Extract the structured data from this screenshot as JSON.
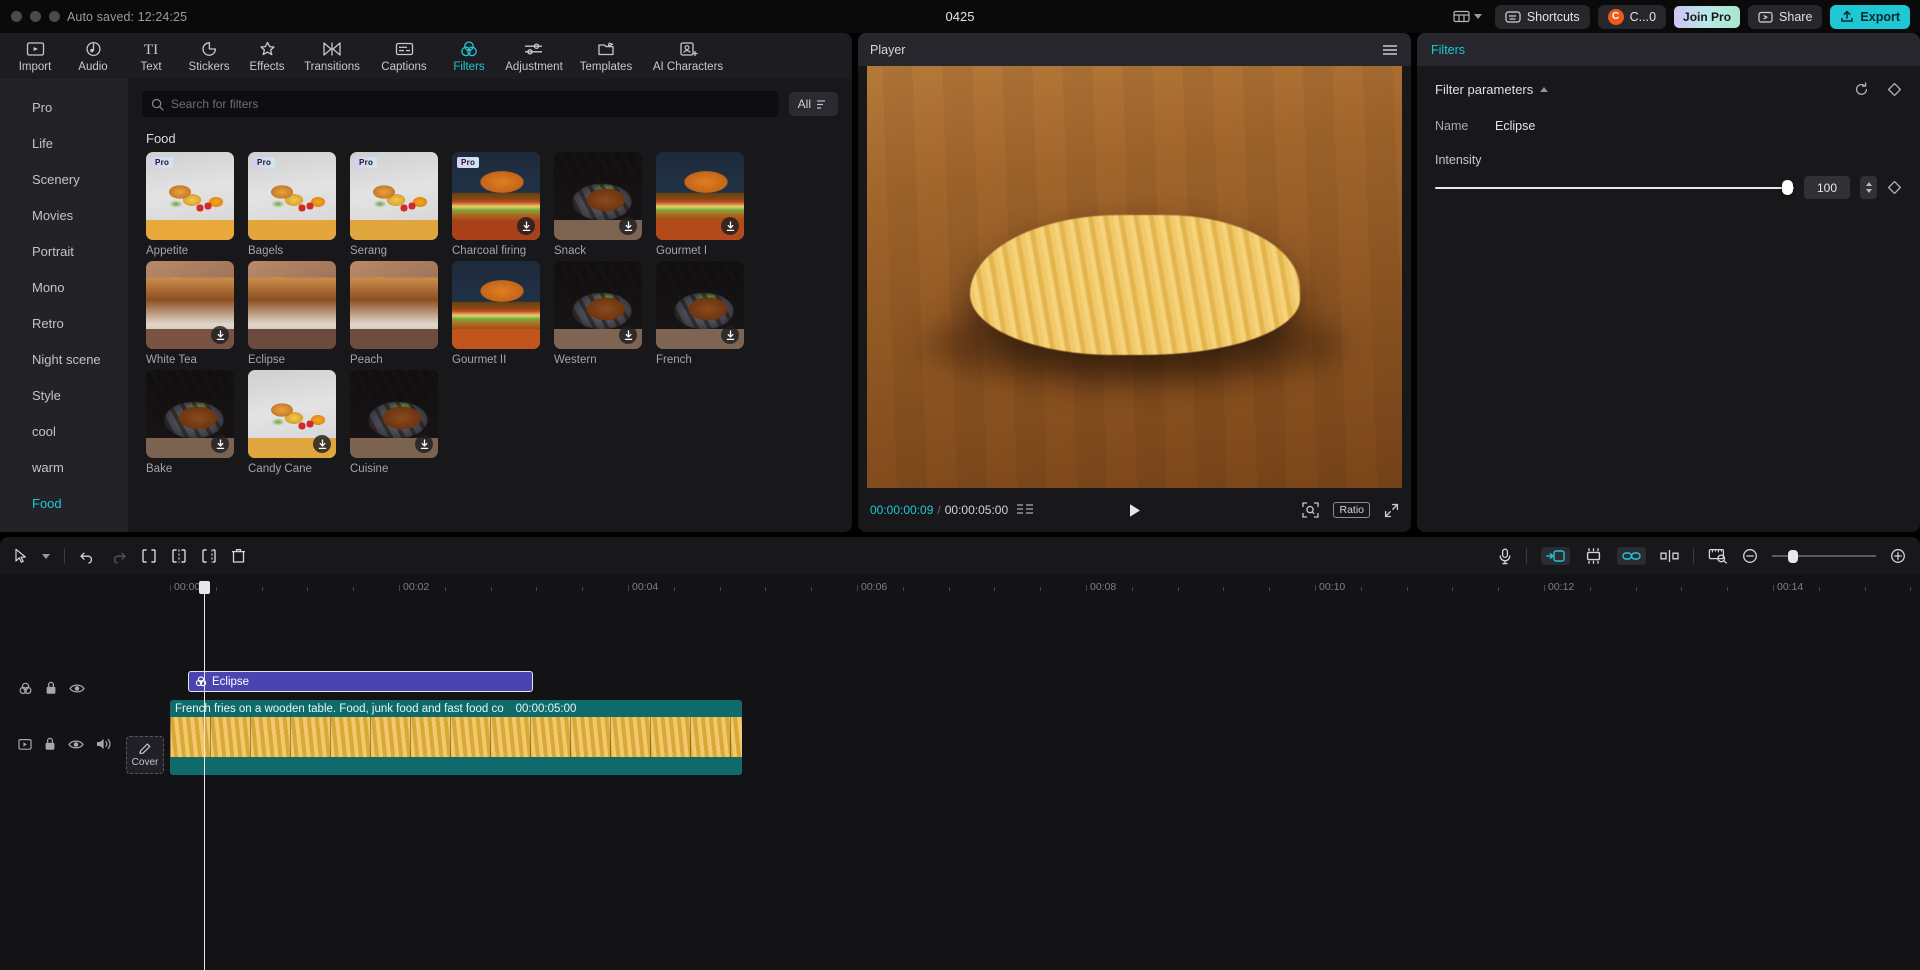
{
  "titlebar": {
    "autosave": "Auto saved: 12:24:25",
    "project_title": "0425",
    "shortcuts_label": "Shortcuts",
    "account_label": "C...0",
    "account_initial": "C",
    "join_pro_label": "Join Pro",
    "share_label": "Share",
    "export_label": "Export"
  },
  "toolbar": {
    "items": [
      {
        "label": "Import",
        "icon": "import-icon",
        "active": false
      },
      {
        "label": "Audio",
        "icon": "audio-icon",
        "active": false
      },
      {
        "label": "Text",
        "icon": "text-icon",
        "active": false
      },
      {
        "label": "Stickers",
        "icon": "stickers-icon",
        "active": false
      },
      {
        "label": "Effects",
        "icon": "effects-icon",
        "active": false
      },
      {
        "label": "Transitions",
        "icon": "transitions-icon",
        "active": false
      },
      {
        "label": "Captions",
        "icon": "captions-icon",
        "active": false
      },
      {
        "label": "Filters",
        "icon": "filters-icon",
        "active": true
      },
      {
        "label": "Adjustment",
        "icon": "adjustment-icon",
        "active": false
      },
      {
        "label": "Templates",
        "icon": "templates-icon",
        "active": false
      },
      {
        "label": "AI Characters",
        "icon": "ai-characters-icon",
        "active": false
      }
    ]
  },
  "categories": {
    "items": [
      {
        "label": "Pro",
        "selected": false
      },
      {
        "label": "Life",
        "selected": false
      },
      {
        "label": "Scenery",
        "selected": false
      },
      {
        "label": "Movies",
        "selected": false
      },
      {
        "label": "Portrait",
        "selected": false
      },
      {
        "label": "Mono",
        "selected": false
      },
      {
        "label": "Retro",
        "selected": false
      },
      {
        "label": "Night scene",
        "selected": false
      },
      {
        "label": "Style",
        "selected": false
      },
      {
        "label": "cool",
        "selected": false
      },
      {
        "label": "warm",
        "selected": false
      },
      {
        "label": "Food",
        "selected": true
      }
    ]
  },
  "browser": {
    "search_placeholder": "Search for filters",
    "search_value": "",
    "filter_button_label": "All",
    "group_title": "Food",
    "tiles": [
      {
        "name": "Appetite",
        "pro": true,
        "download": false,
        "art": "croissant",
        "band": "#e8a93a"
      },
      {
        "name": "Bagels",
        "pro": true,
        "download": false,
        "art": "croissant",
        "band": "#e3a63c"
      },
      {
        "name": "Serang",
        "pro": true,
        "download": false,
        "art": "croissant",
        "band": "#e0a63e"
      },
      {
        "name": "Charcoal firing",
        "pro": true,
        "download": true,
        "art": "burger",
        "band": "#a8411a"
      },
      {
        "name": "Snack",
        "pro": false,
        "download": true,
        "art": "steak",
        "band": "#7d6352"
      },
      {
        "name": "Gourmet I",
        "pro": false,
        "download": true,
        "art": "burger",
        "band": "#b24a1c"
      },
      {
        "name": "White Tea",
        "pro": false,
        "download": true,
        "art": "drink",
        "band": "#7a5244"
      },
      {
        "name": "Eclipse",
        "pro": false,
        "download": false,
        "art": "drink",
        "band": "#6d4a3e"
      },
      {
        "name": "Peach",
        "pro": false,
        "download": false,
        "art": "drink",
        "band": "#6e4c3d"
      },
      {
        "name": "Gourmet II",
        "pro": false,
        "download": false,
        "art": "burger",
        "band": "#c0561c"
      },
      {
        "name": "Western",
        "pro": false,
        "download": true,
        "art": "steak",
        "band": "#7e6553"
      },
      {
        "name": "French",
        "pro": false,
        "download": true,
        "art": "steak",
        "band": "#7e6553"
      },
      {
        "name": "Bake",
        "pro": false,
        "download": true,
        "art": "steak",
        "band": "#7c6351"
      },
      {
        "name": "Candy Cane",
        "pro": false,
        "download": true,
        "art": "croissant",
        "band": "#e0a63e"
      },
      {
        "name": "Cuisine",
        "pro": false,
        "download": true,
        "art": "steak",
        "band": "#7c6351"
      }
    ]
  },
  "player": {
    "title": "Player",
    "current_time": "00:00:00:09",
    "separator": "/",
    "total_time": "00:00:05:00",
    "ratio_label": "Ratio"
  },
  "right_panel": {
    "title": "Filters",
    "section_title": "Filter parameters",
    "name_label": "Name",
    "name_value": "Eclipse",
    "intensity_label": "Intensity",
    "intensity_value": "100",
    "intensity_percent": 100
  },
  "timeline": {
    "ruler_labels": [
      "00:00",
      "00:02",
      "00:04",
      "00:06",
      "00:08",
      "00:10",
      "00:12",
      "00:14"
    ],
    "cover_label": "Cover",
    "filter_clip": {
      "name": "Eclipse"
    },
    "video_clip": {
      "title": "French fries on a wooden table. Food, junk food and fast food co",
      "duration": "00:00:05:00"
    }
  },
  "colors": {
    "accent": "#1fc7d4",
    "filter_clip": "#4a44b0",
    "video_clip": "#0f6b6b",
    "export_bg": "#1fc7d4"
  }
}
